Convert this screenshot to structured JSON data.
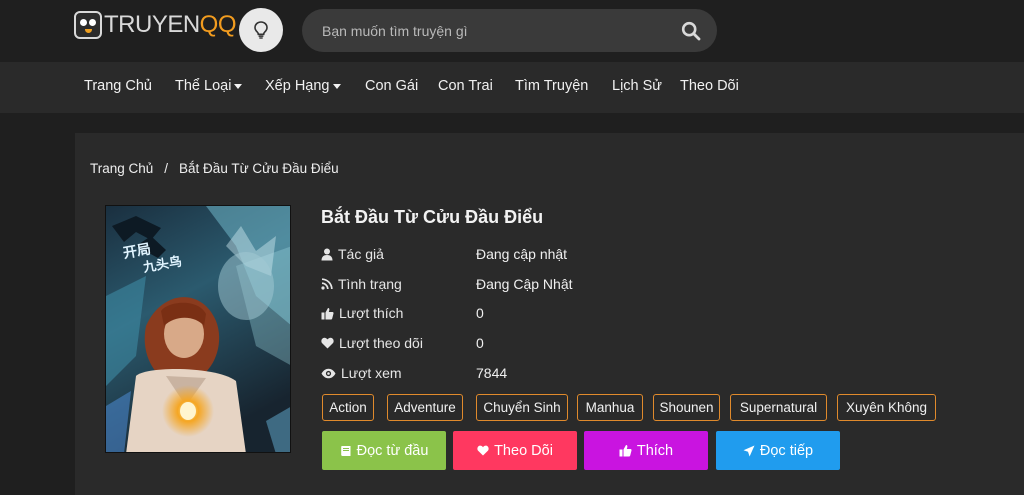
{
  "header": {
    "logo_part1": "TRUYEN",
    "logo_part2": "QQ",
    "search_placeholder": "Bạn muốn tìm truyện gì",
    "icons": [
      "lightbulb-icon",
      "search-icon"
    ]
  },
  "nav": {
    "items": [
      "Trang Chủ",
      "Thể Loại",
      "Xếp Hạng",
      "Con Gái",
      "Con Trai",
      "Tìm Truyện",
      "Lịch Sử",
      "Theo Dõi"
    ]
  },
  "breadcrumb": {
    "items": [
      "Trang Chủ",
      "Bắt Đầu Từ Cửu Đầu Điểu"
    ],
    "separator": "/"
  },
  "comic": {
    "title": "Bắt Đầu Từ Cửu Đầu Điểu",
    "info": [
      {
        "icon": "user-icon",
        "label": "Tác giả",
        "value": "Đang cập nhật"
      },
      {
        "icon": "rss-icon",
        "label": "Tình trạng",
        "value": "Đang Cập Nhật"
      },
      {
        "icon": "thumbs-up-icon",
        "label": "Lượt thích",
        "value": "0"
      },
      {
        "icon": "heart-icon",
        "label": "Lượt theo dõi",
        "value": "0"
      },
      {
        "icon": "eye-icon",
        "label": "Lượt xem",
        "value": "7844"
      }
    ],
    "tags": [
      "Action",
      "Adventure",
      "Chuyển Sinh",
      "Manhua",
      "Shounen",
      "Supernatural",
      "Xuyên Không"
    ]
  },
  "actions": [
    {
      "label": "Đọc từ đầu",
      "icon": "book-icon",
      "color": "#8bc34a"
    },
    {
      "label": "Theo Dõi",
      "icon": "heart-icon",
      "color": "#ff3860"
    },
    {
      "label": "Thích",
      "icon": "thumbs-up-icon",
      "color": "#c914e0"
    },
    {
      "label": "Đọc tiếp",
      "icon": "send-icon",
      "color": "#209cee"
    }
  ],
  "colors": {
    "background": "#1f1f1f",
    "panel": "#2a2a2a",
    "accent": "#f29c1f",
    "tag_border": "#e08a2c"
  }
}
